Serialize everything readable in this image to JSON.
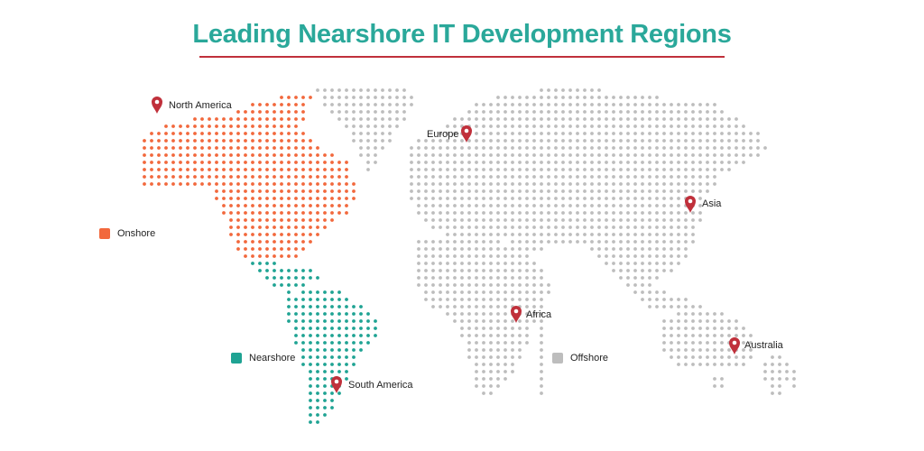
{
  "title": "Leading Nearshore IT Development Regions",
  "colors": {
    "title": "#2aa89a",
    "rule": "#c0303b",
    "onshore": "#f2683c",
    "nearshore": "#1fa393",
    "offshore": "#bdbdbd",
    "pin": "#c0303b"
  },
  "legend": [
    {
      "key": "onshore",
      "label": "Onshore"
    },
    {
      "key": "nearshore",
      "label": "Nearshore"
    },
    {
      "key": "offshore",
      "label": "Offshore"
    }
  ],
  "pins": [
    {
      "key": "north_america",
      "label": "North America",
      "icon": "map-pin-icon"
    },
    {
      "key": "europe",
      "label": "Europe",
      "icon": "map-pin-icon"
    },
    {
      "key": "asia",
      "label": "Asia",
      "icon": "map-pin-icon"
    },
    {
      "key": "africa",
      "label": "Africa",
      "icon": "map-pin-icon"
    },
    {
      "key": "australia",
      "label": "Australia",
      "icon": "map-pin-icon"
    },
    {
      "key": "south_america",
      "label": "South America",
      "icon": "map-pin-icon"
    }
  ]
}
